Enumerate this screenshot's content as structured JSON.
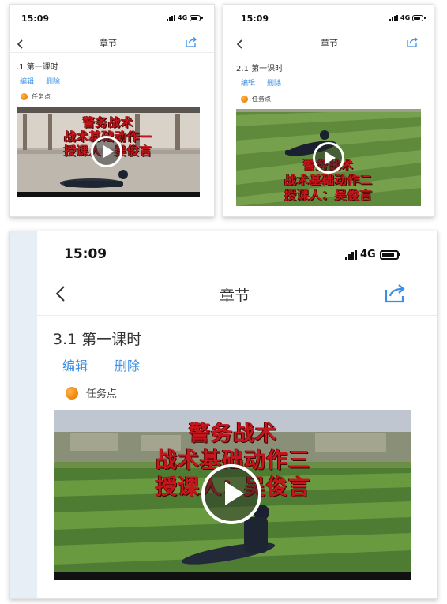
{
  "screens": [
    {
      "status_time": "15:09",
      "network": "4G",
      "nav_title": "章节",
      "lesson_title": ".1 第一课时",
      "edit_label": "编辑",
      "delete_label": "删除",
      "task_label": "任务点",
      "video_caption": [
        "警务战术",
        "战术基础动作一",
        "授课人：吴俊言"
      ]
    },
    {
      "status_time": "15:09",
      "network": "4G",
      "nav_title": "章节",
      "lesson_title": "2.1 第一课时",
      "edit_label": "编辑",
      "delete_label": "删除",
      "task_label": "任务点",
      "video_caption": [
        "警务战术",
        "战术基础动作二",
        "授课人：吴俊言"
      ]
    },
    {
      "status_time": "15:09",
      "network": "4G",
      "nav_title": "章节",
      "lesson_title": "3.1 第一课时",
      "edit_label": "编辑",
      "delete_label": "删除",
      "task_label": "任务点",
      "video_caption": [
        "警务战术",
        "战术基础动作三",
        "授课人：吴俊言"
      ]
    }
  ],
  "icons": {
    "back": "chevron-left-icon",
    "share": "share-icon",
    "play": "play-icon",
    "task": "orange-dot-icon",
    "signal": "signal-bars-icon",
    "battery": "battery-icon"
  },
  "colors": {
    "link": "#3a8ee6",
    "caption": "#c4161c",
    "task_dot": "#f08a12",
    "share_icon": "#3a8ee6"
  }
}
